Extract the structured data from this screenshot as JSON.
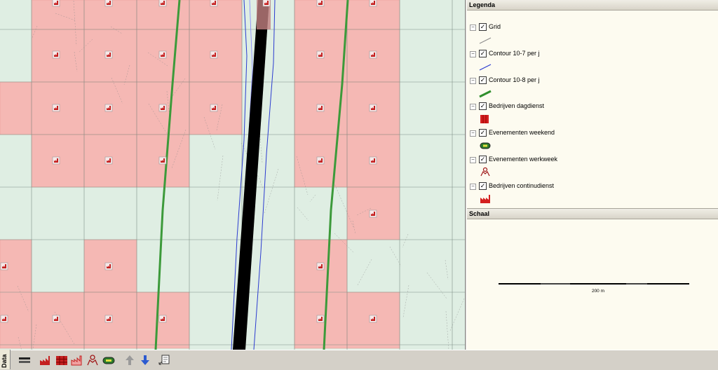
{
  "legend": {
    "title": "Legenda",
    "items": [
      {
        "label": "Grid",
        "checked": true,
        "symbol": "grid-line-icon"
      },
      {
        "label": "Contour 10-7 per j",
        "checked": true,
        "symbol": "blue-line-icon"
      },
      {
        "label": "Contour 10-8 per j",
        "checked": true,
        "symbol": "green-line-icon"
      },
      {
        "label": "Bedrijven dagdienst",
        "checked": true,
        "symbol": "red-square-icon"
      },
      {
        "label": "Evenementen weekend",
        "checked": true,
        "symbol": "stadium-icon"
      },
      {
        "label": "Evenementen werkweek",
        "checked": true,
        "symbol": "crowd-icon"
      },
      {
        "label": "Bedrijven continudienst",
        "checked": true,
        "symbol": "factory-icon"
      }
    ],
    "toggle_glyph": "−",
    "check_glyph": "✓"
  },
  "scale": {
    "title": "Schaal",
    "label": "200 m"
  },
  "toolbar": {
    "tab_label": "Data",
    "buttons": [
      "layer-icon",
      "factory-icon",
      "grid-blocks-icon",
      "factory-outline-icon",
      "crowd-icon",
      "stadium-icon",
      "arrow-up-icon",
      "arrow-down-icon",
      "export-icon"
    ]
  },
  "colors": {
    "map_bg": "#dfeee3",
    "risk_fill": "#f5b8b4",
    "contour_green": "#3c9a3a",
    "contour_blue": "#2b3bd0",
    "track": "#000000"
  }
}
